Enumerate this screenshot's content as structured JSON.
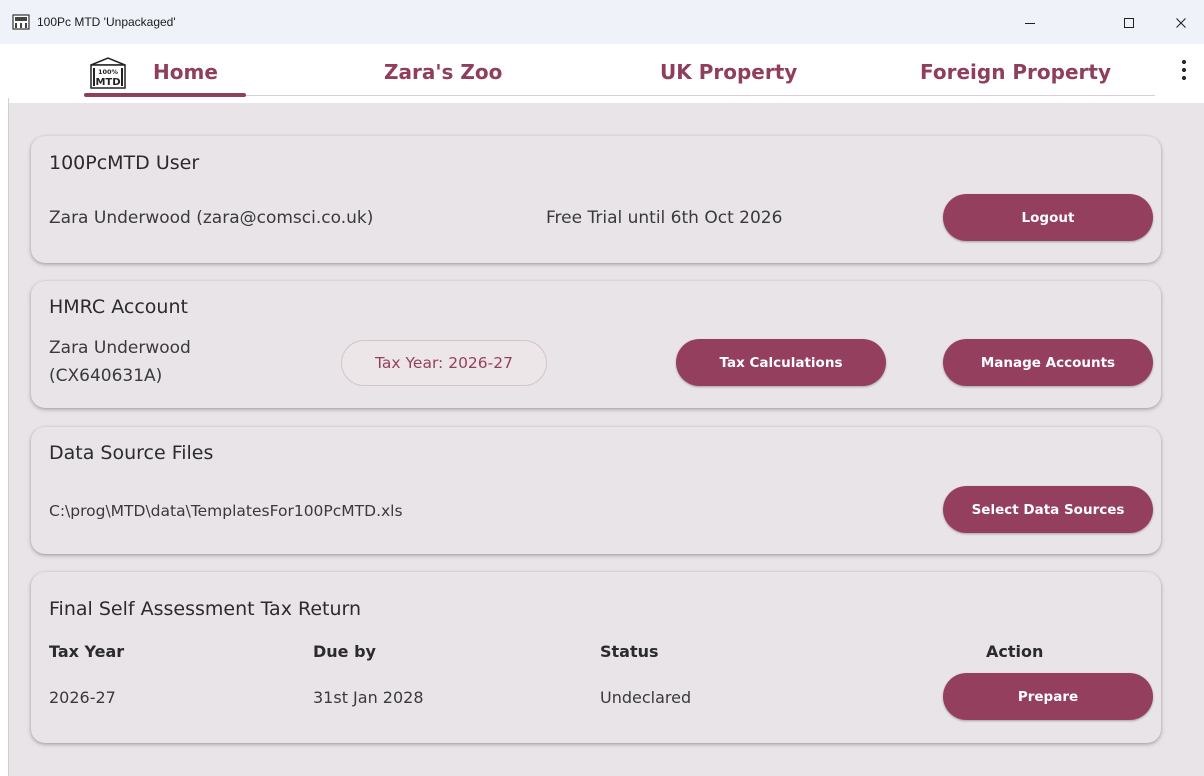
{
  "window": {
    "title": "100Pc MTD 'Unpackaged'",
    "controls": {
      "minimize": "—",
      "maximize": "☐",
      "close": "✕"
    }
  },
  "nav": {
    "logo_text_top": "100%",
    "logo_text_bottom": "MTD",
    "tabs": [
      "Home",
      "Zara's Zoo",
      "UK Property",
      "Foreign Property"
    ],
    "active_tab": "Home",
    "more_icon": "kebab-menu-icon"
  },
  "user_card": {
    "title": "100PcMTD User",
    "name_email": "Zara Underwood  (zara@comsci.co.uk)",
    "trial": "Free Trial until 6th Oct 2026",
    "logout_label": "Logout"
  },
  "hmrc_card": {
    "title": "HMRC Account",
    "name": "Zara Underwood",
    "nino": "(CX640631A)",
    "tax_year_chip": "Tax Year: 2026-27",
    "tax_calc_label": "Tax Calculations",
    "manage_label": "Manage Accounts"
  },
  "data_card": {
    "title": "Data Source Files",
    "path": "C:\\prog\\MTD\\data\\TemplatesFor100PcMTD.xls",
    "select_label": "Select Data Sources"
  },
  "return_card": {
    "title": "Final Self Assessment Tax Return",
    "headers": {
      "tax_year": "Tax Year",
      "due_by": "Due by",
      "status": "Status",
      "action": "Action"
    },
    "row": {
      "tax_year": "2026-27",
      "due_by": "31st Jan 2028",
      "status": "Undeclared",
      "action_label": "Prepare"
    }
  },
  "colors": {
    "accent": "#953f5f",
    "surface": "#e8e4e8",
    "titlebar": "#eff3f9"
  }
}
